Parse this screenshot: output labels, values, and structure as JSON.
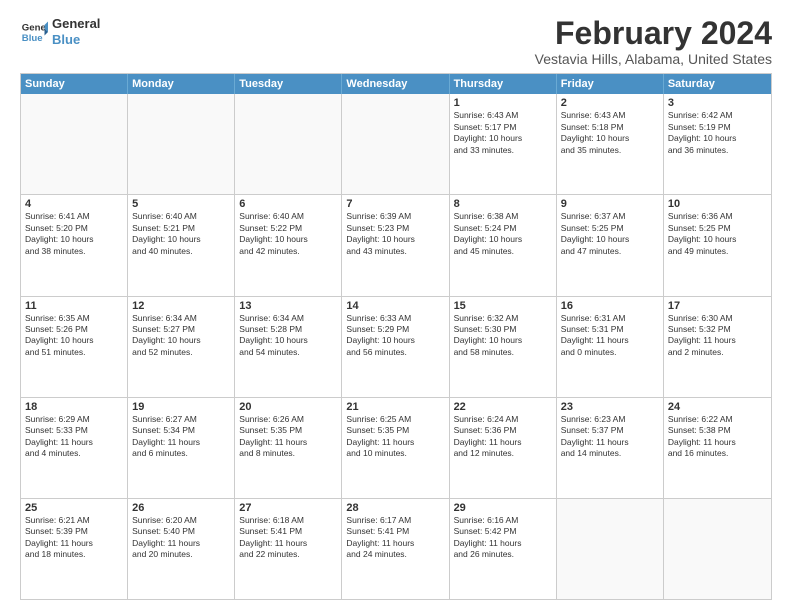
{
  "logo": {
    "line1": "General",
    "line2": "Blue"
  },
  "title": "February 2024",
  "subtitle": "Vestavia Hills, Alabama, United States",
  "header_days": [
    "Sunday",
    "Monday",
    "Tuesday",
    "Wednesday",
    "Thursday",
    "Friday",
    "Saturday"
  ],
  "rows": [
    [
      {
        "day": "",
        "info": ""
      },
      {
        "day": "",
        "info": ""
      },
      {
        "day": "",
        "info": ""
      },
      {
        "day": "",
        "info": ""
      },
      {
        "day": "1",
        "info": "Sunrise: 6:43 AM\nSunset: 5:17 PM\nDaylight: 10 hours\nand 33 minutes."
      },
      {
        "day": "2",
        "info": "Sunrise: 6:43 AM\nSunset: 5:18 PM\nDaylight: 10 hours\nand 35 minutes."
      },
      {
        "day": "3",
        "info": "Sunrise: 6:42 AM\nSunset: 5:19 PM\nDaylight: 10 hours\nand 36 minutes."
      }
    ],
    [
      {
        "day": "4",
        "info": "Sunrise: 6:41 AM\nSunset: 5:20 PM\nDaylight: 10 hours\nand 38 minutes."
      },
      {
        "day": "5",
        "info": "Sunrise: 6:40 AM\nSunset: 5:21 PM\nDaylight: 10 hours\nand 40 minutes."
      },
      {
        "day": "6",
        "info": "Sunrise: 6:40 AM\nSunset: 5:22 PM\nDaylight: 10 hours\nand 42 minutes."
      },
      {
        "day": "7",
        "info": "Sunrise: 6:39 AM\nSunset: 5:23 PM\nDaylight: 10 hours\nand 43 minutes."
      },
      {
        "day": "8",
        "info": "Sunrise: 6:38 AM\nSunset: 5:24 PM\nDaylight: 10 hours\nand 45 minutes."
      },
      {
        "day": "9",
        "info": "Sunrise: 6:37 AM\nSunset: 5:25 PM\nDaylight: 10 hours\nand 47 minutes."
      },
      {
        "day": "10",
        "info": "Sunrise: 6:36 AM\nSunset: 5:25 PM\nDaylight: 10 hours\nand 49 minutes."
      }
    ],
    [
      {
        "day": "11",
        "info": "Sunrise: 6:35 AM\nSunset: 5:26 PM\nDaylight: 10 hours\nand 51 minutes."
      },
      {
        "day": "12",
        "info": "Sunrise: 6:34 AM\nSunset: 5:27 PM\nDaylight: 10 hours\nand 52 minutes."
      },
      {
        "day": "13",
        "info": "Sunrise: 6:34 AM\nSunset: 5:28 PM\nDaylight: 10 hours\nand 54 minutes."
      },
      {
        "day": "14",
        "info": "Sunrise: 6:33 AM\nSunset: 5:29 PM\nDaylight: 10 hours\nand 56 minutes."
      },
      {
        "day": "15",
        "info": "Sunrise: 6:32 AM\nSunset: 5:30 PM\nDaylight: 10 hours\nand 58 minutes."
      },
      {
        "day": "16",
        "info": "Sunrise: 6:31 AM\nSunset: 5:31 PM\nDaylight: 11 hours\nand 0 minutes."
      },
      {
        "day": "17",
        "info": "Sunrise: 6:30 AM\nSunset: 5:32 PM\nDaylight: 11 hours\nand 2 minutes."
      }
    ],
    [
      {
        "day": "18",
        "info": "Sunrise: 6:29 AM\nSunset: 5:33 PM\nDaylight: 11 hours\nand 4 minutes."
      },
      {
        "day": "19",
        "info": "Sunrise: 6:27 AM\nSunset: 5:34 PM\nDaylight: 11 hours\nand 6 minutes."
      },
      {
        "day": "20",
        "info": "Sunrise: 6:26 AM\nSunset: 5:35 PM\nDaylight: 11 hours\nand 8 minutes."
      },
      {
        "day": "21",
        "info": "Sunrise: 6:25 AM\nSunset: 5:35 PM\nDaylight: 11 hours\nand 10 minutes."
      },
      {
        "day": "22",
        "info": "Sunrise: 6:24 AM\nSunset: 5:36 PM\nDaylight: 11 hours\nand 12 minutes."
      },
      {
        "day": "23",
        "info": "Sunrise: 6:23 AM\nSunset: 5:37 PM\nDaylight: 11 hours\nand 14 minutes."
      },
      {
        "day": "24",
        "info": "Sunrise: 6:22 AM\nSunset: 5:38 PM\nDaylight: 11 hours\nand 16 minutes."
      }
    ],
    [
      {
        "day": "25",
        "info": "Sunrise: 6:21 AM\nSunset: 5:39 PM\nDaylight: 11 hours\nand 18 minutes."
      },
      {
        "day": "26",
        "info": "Sunrise: 6:20 AM\nSunset: 5:40 PM\nDaylight: 11 hours\nand 20 minutes."
      },
      {
        "day": "27",
        "info": "Sunrise: 6:18 AM\nSunset: 5:41 PM\nDaylight: 11 hours\nand 22 minutes."
      },
      {
        "day": "28",
        "info": "Sunrise: 6:17 AM\nSunset: 5:41 PM\nDaylight: 11 hours\nand 24 minutes."
      },
      {
        "day": "29",
        "info": "Sunrise: 6:16 AM\nSunset: 5:42 PM\nDaylight: 11 hours\nand 26 minutes."
      },
      {
        "day": "",
        "info": ""
      },
      {
        "day": "",
        "info": ""
      }
    ]
  ]
}
